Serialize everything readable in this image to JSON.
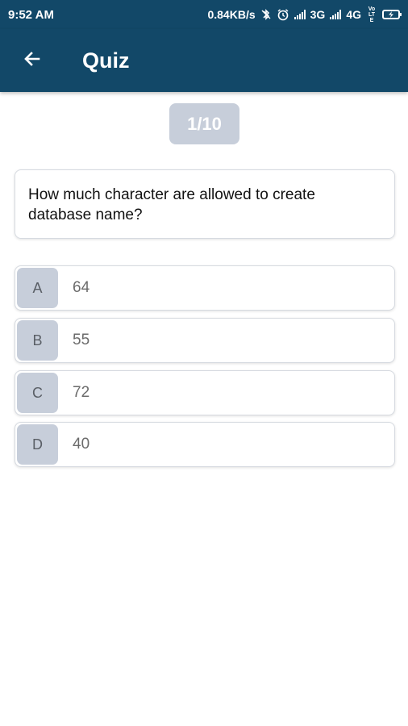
{
  "status_bar": {
    "time": "9:52 AM",
    "speed": "0.84KB/s",
    "network_3g": "3G",
    "network_4g": "4G",
    "volte": "VoLTE"
  },
  "app_bar": {
    "title": "Quiz",
    "back_icon": "arrow-left-icon"
  },
  "quiz": {
    "counter": "1/10",
    "current": 1,
    "total": 10,
    "question": "How much character are allowed to create database name?",
    "options": [
      {
        "letter": "A",
        "text": "64"
      },
      {
        "letter": "B",
        "text": "55"
      },
      {
        "letter": "C",
        "text": "72"
      },
      {
        "letter": "D",
        "text": "40"
      }
    ]
  },
  "colors": {
    "primary": "#124868",
    "option_letter_bg": "#c7ceda",
    "counter_bg": "#c7ceda",
    "border": "#d6dae0"
  }
}
